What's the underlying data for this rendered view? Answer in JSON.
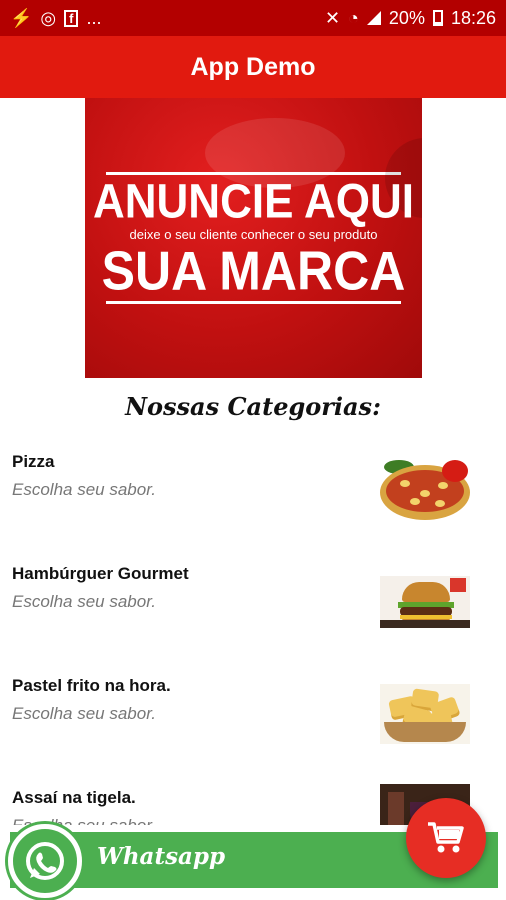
{
  "status_bar": {
    "notification_icons": [
      "usb-debug-icon",
      "whatsapp-icon",
      "facebook-icon"
    ],
    "overflow_text": "...",
    "system_icons": [
      "mute-icon",
      "wifi-icon",
      "signal-icon",
      "battery-icon"
    ],
    "battery": "20%",
    "time": "18:26"
  },
  "appbar": {
    "title": "App Demo"
  },
  "banner": {
    "headline": "ANUNCIE AQUI",
    "subtitle": "deixe o seu cliente conhecer o seu produto",
    "brand": "SUA MARCA"
  },
  "section_title": "Nossas Categorias:",
  "categories": [
    {
      "name": "Pizza",
      "description": "Escolha seu sabor.",
      "thumbnail": "pizza-thumbnail"
    },
    {
      "name": "Hambúrguer Gourmet",
      "description": "Escolha seu sabor.",
      "thumbnail": "burger-thumbnail"
    },
    {
      "name": "Pastel frito na hora.",
      "description": "Escolha seu sabor.",
      "thumbnail": "pastel-thumbnail"
    },
    {
      "name": "Assaí na tigela.",
      "description": "Escolha seu sabor.",
      "thumbnail": "acai-thumbnail"
    }
  ],
  "whatsapp": {
    "label": "Whatsapp"
  },
  "colors": {
    "status_bar": "#b30000",
    "app_bar": "#e11a0f",
    "banner": "#c01010",
    "whatsapp_green": "#4caf50",
    "cart_red": "#e62d24"
  }
}
